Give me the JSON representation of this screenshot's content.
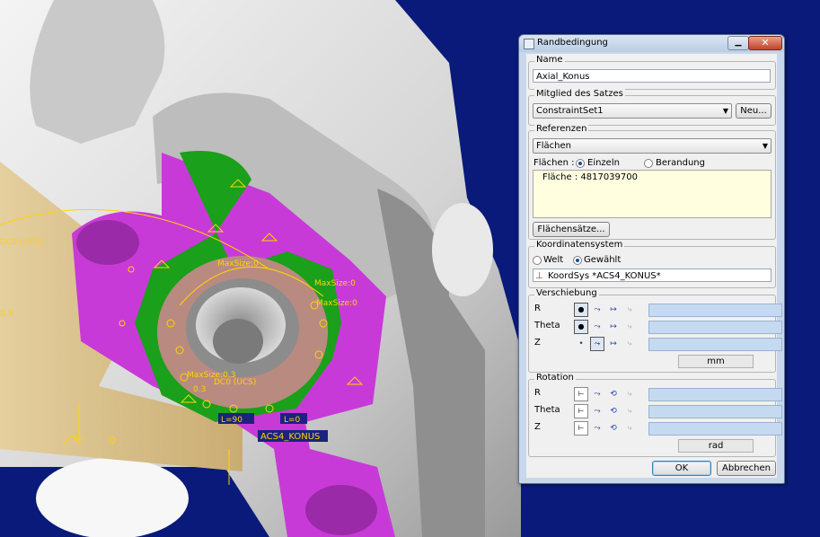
{
  "dialog": {
    "title": "Randbedingung",
    "close_glyph": "✕",
    "minimize_glyph": "▁",
    "name_section": {
      "label": "Name",
      "value": "Axial_Konus"
    },
    "set_section": {
      "label": "Mitglied des Satzes",
      "selected": "ConstraintSet1",
      "new_button": "Neu..."
    },
    "references": {
      "label": "Referenzen",
      "type_selected": "Flächen",
      "mode_label": "Flächen :",
      "mode_options": [
        "Einzeln",
        "Berandung"
      ],
      "mode_selected": "Einzeln",
      "items": [
        "Fläche : 4817039700"
      ],
      "surface_sets_button": "Flächensätze..."
    },
    "coordinate_system": {
      "label": "Koordinatensystem",
      "options": [
        "Welt",
        "Gewählt"
      ],
      "selected": "Gewählt",
      "value": "KoordSys *ACS4_KONUS*"
    },
    "translation": {
      "label": "Verschiebung",
      "rows": [
        {
          "axis": "R",
          "state": "fixed"
        },
        {
          "axis": "Theta",
          "state": "fixed"
        },
        {
          "axis": "Z",
          "state": "free"
        }
      ],
      "unit": "mm"
    },
    "rotation": {
      "label": "Rotation",
      "rows": [
        {
          "axis": "R",
          "state": "free"
        },
        {
          "axis": "Theta",
          "state": "free"
        },
        {
          "axis": "Z",
          "state": "free"
        }
      ],
      "unit": "rad"
    },
    "ok_button": "OK",
    "cancel_button": "Abbrechen"
  },
  "viewport": {
    "annotations": [
      "MaxSize:0",
      "MaxSize:0",
      "MaxSize:0.3",
      "MaxSize:0",
      "L=90",
      "L=0",
      "ACS4_KONUS",
      "0.3",
      "0.3",
      "DC0 (UCS)",
      "DC0 (UCS)"
    ]
  }
}
